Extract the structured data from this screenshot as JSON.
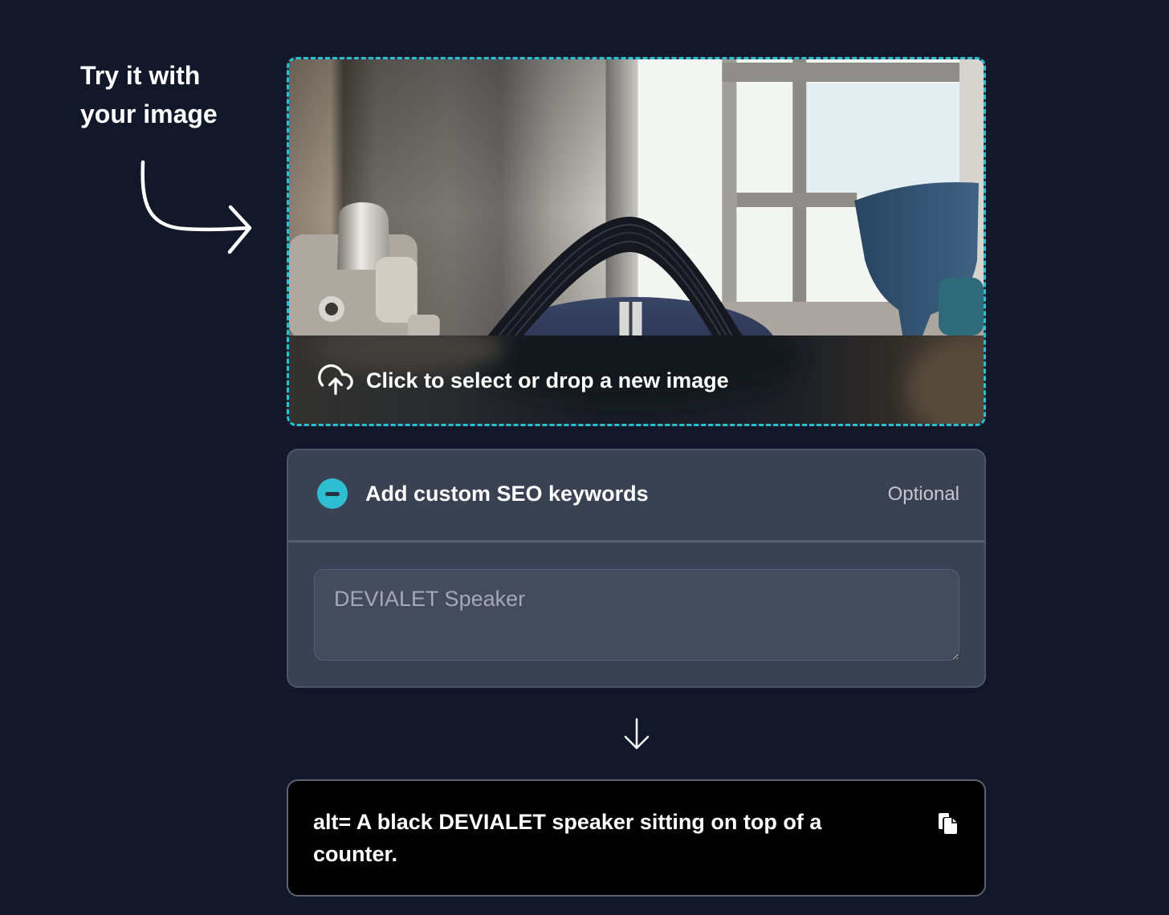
{
  "hint": {
    "line1": "Try it with",
    "line2": "your image",
    "arrow_icon": "curved-arrow-icon"
  },
  "upload": {
    "label": "Click to select or drop a new image",
    "icon": "upload-cloud-icon"
  },
  "keywords": {
    "title": "Add custom SEO keywords",
    "optional_label": "Optional",
    "value": "DEVIALET Speaker",
    "toggle_icon": "minus-circle-icon"
  },
  "flow": {
    "icon": "arrow-down-icon"
  },
  "result": {
    "text": "alt= A black DEVIALET speaker sitting on top of a counter.",
    "copy_icon": "copy-icon"
  },
  "colors": {
    "background": "#121829",
    "accent": "#2bbfd3",
    "card": "#394153",
    "input": "#434b5d",
    "result_background": "#000000",
    "text": "#ffffff"
  }
}
